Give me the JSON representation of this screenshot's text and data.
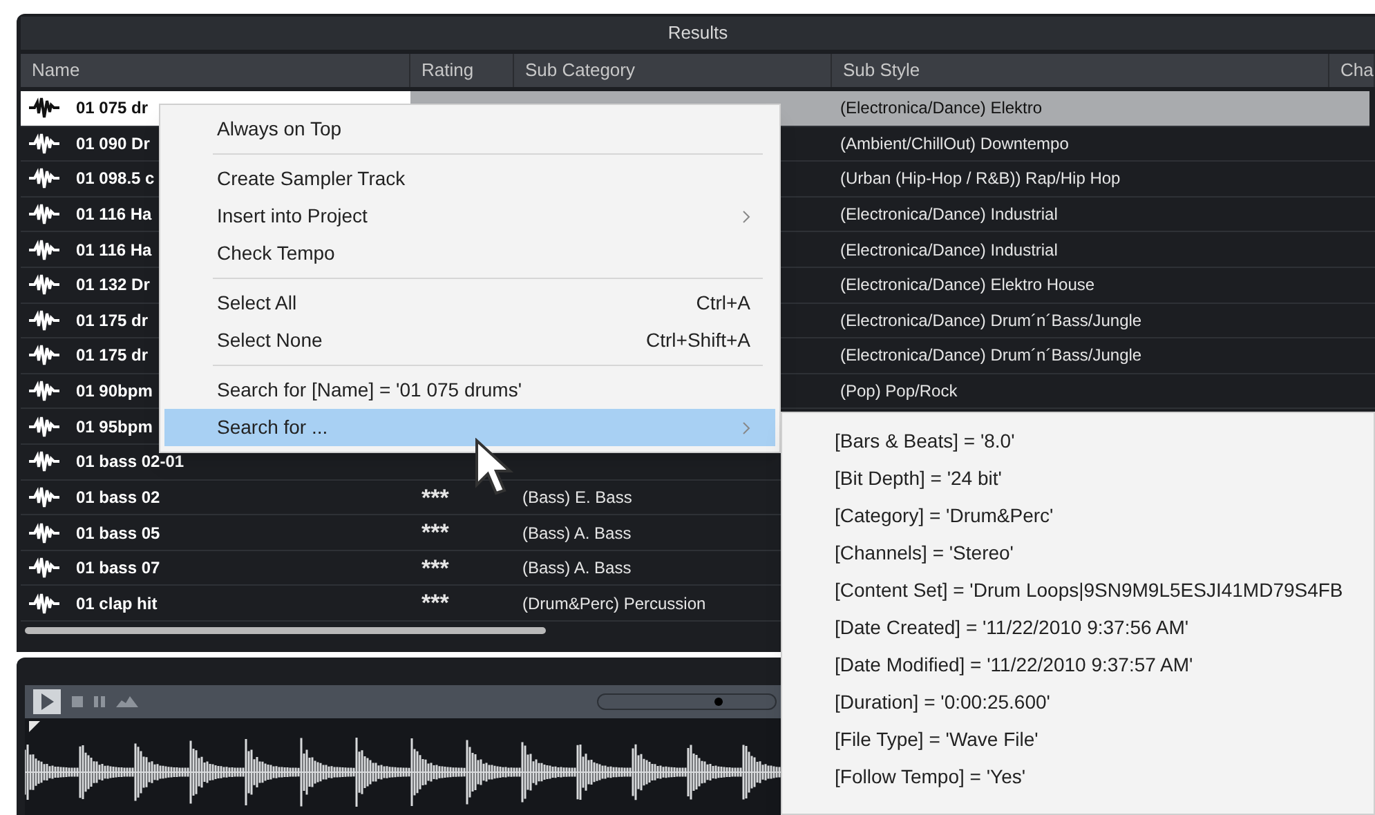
{
  "panel_title": "Results",
  "columns": [
    {
      "label": "Name"
    },
    {
      "label": "Rating"
    },
    {
      "label": "Sub Category"
    },
    {
      "label": "Sub Style"
    },
    {
      "label": "Cha"
    }
  ],
  "rows": [
    {
      "name": "01 075 dr",
      "selected": true,
      "sub_style": "(Electronica/Dance) Elektro"
    },
    {
      "name": "01 090 Dr",
      "selected": false,
      "sub_style": "(Ambient/ChillOut) Downtempo"
    },
    {
      "name": "01 098.5 c",
      "selected": false,
      "sub_style": "(Urban (Hip-Hop / R&B)) Rap/Hip Hop"
    },
    {
      "name": "01 116 Ha",
      "selected": false,
      "sub_style": "(Electronica/Dance) Industrial"
    },
    {
      "name": "01 116 Ha",
      "selected": false,
      "sub_style": "(Electronica/Dance) Industrial"
    },
    {
      "name": "01 132 Dr",
      "selected": false,
      "sub_style": "(Electronica/Dance) Elektro House"
    },
    {
      "name": "01 175 dr",
      "selected": false,
      "sub_style": "(Electronica/Dance) Drum´n´Bass/Jungle"
    },
    {
      "name": "01 175 dr",
      "selected": false,
      "sub_style": "(Electronica/Dance) Drum´n´Bass/Jungle"
    },
    {
      "name": "01 90bpm",
      "selected": false,
      "sub_style": "(Pop) Pop/Rock"
    },
    {
      "name": "01 95bpm",
      "selected": false
    },
    {
      "name": "01 bass 02-01",
      "selected": false
    },
    {
      "name": "01 bass 02",
      "selected": false,
      "rating": "***",
      "sub_category": "(Bass) E. Bass"
    },
    {
      "name": "01 bass 05",
      "selected": false,
      "rating": "***",
      "sub_category": "(Bass) A. Bass"
    },
    {
      "name": "01 bass 07",
      "selected": false,
      "rating": "***",
      "sub_category": "(Bass) A. Bass"
    },
    {
      "name": "01 clap hit",
      "selected": false,
      "rating": "***",
      "sub_category": "(Drum&Perc) Percussion"
    }
  ],
  "transport": {
    "zoom_slider": {
      "level": 0.68
    }
  },
  "context_menu": {
    "groups": [
      [
        {
          "label": "Always on Top",
          "selected": false,
          "has_submenu": false
        }
      ],
      [
        {
          "label": "Create Sampler Track",
          "selected": false,
          "has_submenu": false
        },
        {
          "label": "Insert into Project",
          "selected": false,
          "has_submenu": true
        },
        {
          "label": "Check Tempo",
          "selected": false,
          "has_submenu": false
        }
      ],
      [
        {
          "label": "Select All",
          "shortcut": "Ctrl+A",
          "selected": false,
          "has_submenu": false
        },
        {
          "label": "Select None",
          "shortcut": "Ctrl+Shift+A",
          "selected": false,
          "has_submenu": false
        }
      ],
      [
        {
          "label": "Search for [Name] = '01 075 drums'",
          "selected": false,
          "has_submenu": false
        },
        {
          "label": "Search for ...",
          "selected": true,
          "has_submenu": true
        }
      ]
    ]
  },
  "submenu": {
    "items": [
      "[Bars & Beats] = '8.0'",
      "[Bit Depth] = '24 bit'",
      "[Category] = 'Drum&Perc'",
      "[Channels] = 'Stereo'",
      "[Content Set] = 'Drum Loops|9SN9M9L5ESJI41MD79S4FB",
      "[Date Created] = '11/22/2010 9:37:56 AM'",
      "[Date Modified] = '11/22/2010 9:37:57 AM'",
      "[Duration] = '0:00:25.600'",
      "[File Type] = 'Wave File'",
      "[Follow Tempo] = 'Yes'"
    ]
  }
}
